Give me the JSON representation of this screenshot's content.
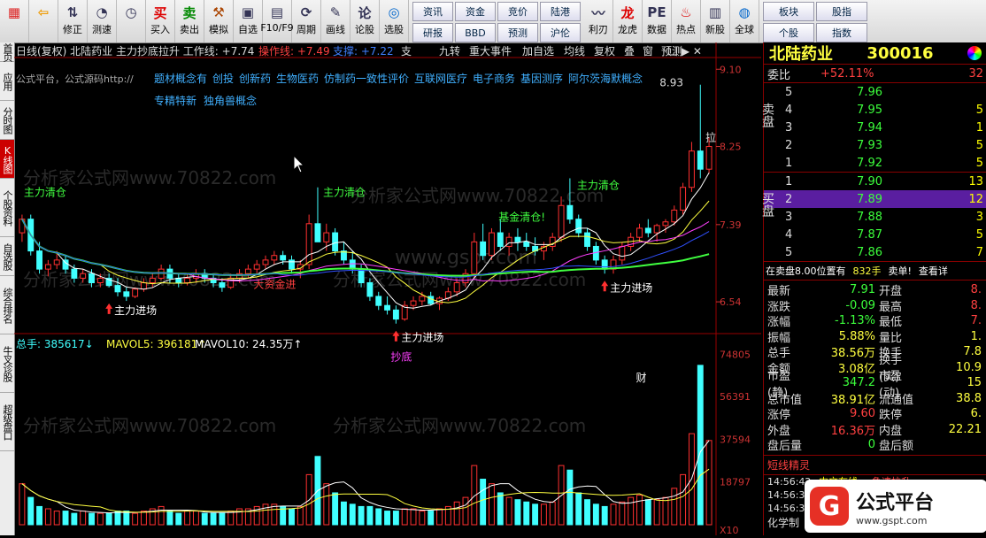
{
  "toolbar": {
    "buttons": [
      {
        "label": "",
        "icon": "windows-icon"
      },
      {
        "label": "",
        "icon": "back-arrow-icon"
      },
      {
        "label": "修正",
        "icon": "up-down-arrow-icon"
      },
      {
        "label": "测速",
        "icon": "speedometer-icon"
      },
      {
        "label": "",
        "icon": "clock-icon"
      },
      {
        "label": "买入",
        "icon": "buy-icon"
      },
      {
        "label": "卖出",
        "icon": "sell-icon"
      },
      {
        "label": "模拟",
        "icon": "hammer-icon"
      },
      {
        "label": "自选",
        "icon": "save-icon"
      },
      {
        "label": "F10/F9",
        "icon": "window-icon"
      },
      {
        "label": "周期",
        "icon": "cycle-icon"
      },
      {
        "label": "画线",
        "icon": "pen-icon"
      },
      {
        "label": "论股",
        "icon": "chat-icon"
      },
      {
        "label": "选股",
        "icon": "search-chart-icon"
      }
    ],
    "grid1": [
      "资讯",
      "资金",
      "竞价",
      "陆港",
      "研报",
      "BBD",
      "预测",
      "沪伦"
    ],
    "tail": [
      {
        "label": "利刃",
        "icon": "chart-icon"
      },
      {
        "label": "龙虎",
        "icon": "dragon-icon"
      },
      {
        "label": "数据",
        "icon": "pe-icon"
      },
      {
        "label": "热点",
        "icon": "fire-icon"
      },
      {
        "label": "新股",
        "icon": "ipo-icon"
      },
      {
        "label": "全球",
        "icon": "globe-icon"
      }
    ],
    "grid2": [
      "板块",
      "股指",
      "个股",
      "指数"
    ]
  },
  "sidebar": [
    "首页",
    "应用",
    "分时图",
    "K线图",
    "个股资料",
    "自选股",
    "综合排名",
    "牛叉诊股",
    "超级盘口"
  ],
  "chart_header": {
    "line1": "日线(复权)  北陆药业  主力抄底拉升  工作线: +7.74",
    "op_line": "操作线: +7.49",
    "support_line": "支撑: +7.22",
    "support_label": "支",
    "menu": [
      "九转",
      "重大事件",
      "加自选",
      "均线",
      "复权",
      "叠",
      "窗",
      "预测"
    ],
    "line2": "公式平台，公式源码http://",
    "concepts1": [
      "题材概念有",
      "创投",
      "创新药",
      "生物医药",
      "仿制药一致性评价",
      "互联网医疗",
      "电子商务",
      "基因测序",
      "阿尔茨海默概念"
    ],
    "concepts2": [
      "专精特新",
      "独角兽概念"
    ]
  },
  "price_axis": [
    "9.10",
    "8.25",
    "7.39",
    "6.54"
  ],
  "vol_axis": [
    "74805",
    "56391",
    "37594",
    "18797",
    "X10"
  ],
  "annotations": {
    "peak": "8.93",
    "la": "拉",
    "clear1": "主力清仓",
    "clear2": "主力清仓",
    "clear3": "主力清仓",
    "fund_clear": "基金清仓!",
    "enter1": "主力进场",
    "enter2": "主力进场",
    "enter3": "主力进场",
    "big_fund": "大资金进",
    "bottom": "抄底",
    "cai": "财",
    "watermark": "分析家公式网www.70822.com",
    "gspt": "www.gspt.com"
  },
  "vol_header": {
    "total": "总手: 385617↓",
    "mavol5": "MAVOL5: 396181↑",
    "mavol10": "MAVOL10: 24.35万↑"
  },
  "right_panel": {
    "name": "北陆药业",
    "code": "300016",
    "weibi_label": "委比",
    "weibi_val": "+52.11%",
    "weibi_diff": "32",
    "sell_label": "卖盘",
    "buy_label": "买盘",
    "asks": [
      {
        "n": "5",
        "p": "7.96",
        "v": ""
      },
      {
        "n": "4",
        "p": "7.95",
        "v": "5"
      },
      {
        "n": "3",
        "p": "7.94",
        "v": "1"
      },
      {
        "n": "2",
        "p": "7.93",
        "v": "5"
      },
      {
        "n": "1",
        "p": "7.92",
        "v": "5"
      }
    ],
    "bids": [
      {
        "n": "1",
        "p": "7.90",
        "v": "13"
      },
      {
        "n": "2",
        "p": "7.89",
        "v": "12"
      },
      {
        "n": "3",
        "p": "7.88",
        "v": "3"
      },
      {
        "n": "4",
        "p": "7.87",
        "v": "5"
      },
      {
        "n": "5",
        "p": "7.86",
        "v": "7"
      }
    ],
    "pending": {
      "a": "在卖盘8.00位置有",
      "b": "832手",
      "c": "卖单!",
      "d": "查看详"
    },
    "quotes": [
      [
        "最新",
        "7.91",
        "开盘",
        "8."
      ],
      [
        "涨跌",
        "-0.09",
        "最高",
        "8."
      ],
      [
        "涨幅",
        "-1.13%",
        "最低",
        "7."
      ],
      [
        "振幅",
        "5.88%",
        "量比",
        "1."
      ],
      [
        "总手",
        "38.56万",
        "换手",
        "7.8"
      ],
      [
        "金额",
        "3.08亿",
        "换手(实)",
        "10.9"
      ],
      [
        "市盈(静)",
        "347.2",
        "市盈(动)",
        "15"
      ],
      [
        "总市值",
        "38.91亿",
        "流通值",
        "38.8"
      ],
      [
        "涨停",
        "9.60",
        "跌停",
        "6."
      ],
      [
        "外盘",
        "16.36万",
        "内盘",
        "22.21"
      ],
      [
        "盘后量",
        "0",
        "盘后额",
        ""
      ]
    ],
    "elf_title": "短线精灵",
    "elf_rows": [
      {
        "t": "14:56:42",
        "s": "中文在线",
        "e": "急速拉升"
      },
      {
        "t": "14:56:38",
        "s": "",
        "e": ""
      },
      {
        "t": "14:56:35",
        "s": "",
        "e": ""
      }
    ],
    "footer": "化学制",
    "logo": "公式平台",
    "logo_url": "www.gspt.com"
  },
  "chart_data": {
    "type": "candlestick",
    "price_range": [
      6.2,
      9.2
    ],
    "candles": [
      [
        7.3,
        7.5,
        7.2,
        7.45
      ],
      [
        7.45,
        7.5,
        7.05,
        7.1
      ],
      [
        7.1,
        7.2,
        6.85,
        6.9
      ],
      [
        6.9,
        7.0,
        6.82,
        6.95
      ],
      [
        6.95,
        7.1,
        6.9,
        7.0
      ],
      [
        7.0,
        7.05,
        6.85,
        6.9
      ],
      [
        6.9,
        6.95,
        6.75,
        6.8
      ],
      [
        6.8,
        6.9,
        6.75,
        6.85
      ],
      [
        6.85,
        6.9,
        6.7,
        6.75
      ],
      [
        6.75,
        6.85,
        6.7,
        6.8
      ],
      [
        6.8,
        6.85,
        6.7,
        6.72
      ],
      [
        6.72,
        6.8,
        6.6,
        6.65
      ],
      [
        6.65,
        6.7,
        6.55,
        6.6
      ],
      [
        6.6,
        6.7,
        6.58,
        6.68
      ],
      [
        6.68,
        6.8,
        6.65,
        6.75
      ],
      [
        6.75,
        6.85,
        6.7,
        6.8
      ],
      [
        6.8,
        6.95,
        6.78,
        6.9
      ],
      [
        6.9,
        6.95,
        6.75,
        6.8
      ],
      [
        6.8,
        6.85,
        6.7,
        6.75
      ],
      [
        6.75,
        6.85,
        6.72,
        6.8
      ],
      [
        6.8,
        6.9,
        6.75,
        6.85
      ],
      [
        6.85,
        6.9,
        6.75,
        6.8
      ],
      [
        6.8,
        6.85,
        6.7,
        6.75
      ],
      [
        6.75,
        6.8,
        6.65,
        6.7
      ],
      [
        6.7,
        6.85,
        6.68,
        6.8
      ],
      [
        6.8,
        6.9,
        6.75,
        6.85
      ],
      [
        6.85,
        6.95,
        6.8,
        6.9
      ],
      [
        6.9,
        7.0,
        6.85,
        6.95
      ],
      [
        6.95,
        7.05,
        6.9,
        7.0
      ],
      [
        7.0,
        7.1,
        6.95,
        7.05
      ],
      [
        7.05,
        7.1,
        6.95,
        7.0
      ],
      [
        7.0,
        7.05,
        6.85,
        6.9
      ],
      [
        6.9,
        7.0,
        6.8,
        6.95
      ],
      [
        6.95,
        7.5,
        6.9,
        7.4
      ],
      [
        7.4,
        7.8,
        7.3,
        7.2
      ],
      [
        7.2,
        7.4,
        7.1,
        7.3
      ],
      [
        7.3,
        7.35,
        7.05,
        7.1
      ],
      [
        7.1,
        7.2,
        6.95,
        7.0
      ],
      [
        7.0,
        7.1,
        6.85,
        6.9
      ],
      [
        6.9,
        6.95,
        6.7,
        6.75
      ],
      [
        6.75,
        6.8,
        6.55,
        6.6
      ],
      [
        6.6,
        6.65,
        6.45,
        6.5
      ],
      [
        6.5,
        6.6,
        6.4,
        6.45
      ],
      [
        6.45,
        6.5,
        6.3,
        6.35
      ],
      [
        6.35,
        6.55,
        6.33,
        6.5
      ],
      [
        6.5,
        6.6,
        6.45,
        6.55
      ],
      [
        6.55,
        6.65,
        6.5,
        6.6
      ],
      [
        6.6,
        6.65,
        6.5,
        6.52
      ],
      [
        6.52,
        6.6,
        6.45,
        6.58
      ],
      [
        6.58,
        6.7,
        6.55,
        6.65
      ],
      [
        6.65,
        6.8,
        6.6,
        6.75
      ],
      [
        6.75,
        6.9,
        6.7,
        6.85
      ],
      [
        6.85,
        7.3,
        6.8,
        7.2
      ],
      [
        7.2,
        7.4,
        7.0,
        7.05
      ],
      [
        7.05,
        7.35,
        7.0,
        7.3
      ],
      [
        7.3,
        7.45,
        7.1,
        7.15
      ],
      [
        7.15,
        7.3,
        7.05,
        7.25
      ],
      [
        7.25,
        7.35,
        7.1,
        7.2
      ],
      [
        7.2,
        7.3,
        7.1,
        7.15
      ],
      [
        7.15,
        7.25,
        7.05,
        7.1
      ],
      [
        7.1,
        7.2,
        7.0,
        7.15
      ],
      [
        7.15,
        7.3,
        7.1,
        7.25
      ],
      [
        7.25,
        7.7,
        7.2,
        7.6
      ],
      [
        7.6,
        7.9,
        7.4,
        7.45
      ],
      [
        7.45,
        7.5,
        7.25,
        7.3
      ],
      [
        7.3,
        7.35,
        7.1,
        7.15
      ],
      [
        7.15,
        7.2,
        6.95,
        7.0
      ],
      [
        7.0,
        7.05,
        6.85,
        6.9
      ],
      [
        6.9,
        7.05,
        6.85,
        7.0
      ],
      [
        7.0,
        7.2,
        6.95,
        7.15
      ],
      [
        7.15,
        7.3,
        7.1,
        7.25
      ],
      [
        7.25,
        7.4,
        7.2,
        7.35
      ],
      [
        7.35,
        7.45,
        7.25,
        7.3
      ],
      [
        7.3,
        7.4,
        7.2,
        7.38
      ],
      [
        7.38,
        7.45,
        7.3,
        7.42
      ],
      [
        7.42,
        7.6,
        7.38,
        7.55
      ],
      [
        7.55,
        7.85,
        7.5,
        7.8
      ],
      [
        7.8,
        8.3,
        7.75,
        8.2
      ],
      [
        8.2,
        8.93,
        7.9,
        8.0
      ],
      [
        8.0,
        8.35,
        7.95,
        8.25
      ]
    ],
    "volumes": [
      18,
      12,
      8,
      7,
      6,
      6,
      5,
      6,
      5,
      5,
      5,
      6,
      6,
      5,
      6,
      7,
      8,
      6,
      5,
      6,
      6,
      5,
      5,
      5,
      6,
      7,
      7,
      8,
      9,
      9,
      8,
      7,
      8,
      22,
      30,
      18,
      14,
      10,
      9,
      8,
      8,
      7,
      6,
      6,
      7,
      7,
      6,
      6,
      7,
      8,
      10,
      12,
      26,
      20,
      18,
      14,
      12,
      11,
      10,
      9,
      9,
      10,
      26,
      24,
      14,
      11,
      9,
      8,
      9,
      10,
      12,
      13,
      11,
      11,
      12,
      16,
      22,
      40,
      70,
      37
    ],
    "ma_lines": [
      "white",
      "yellow",
      "magenta",
      "green",
      "blue"
    ]
  }
}
